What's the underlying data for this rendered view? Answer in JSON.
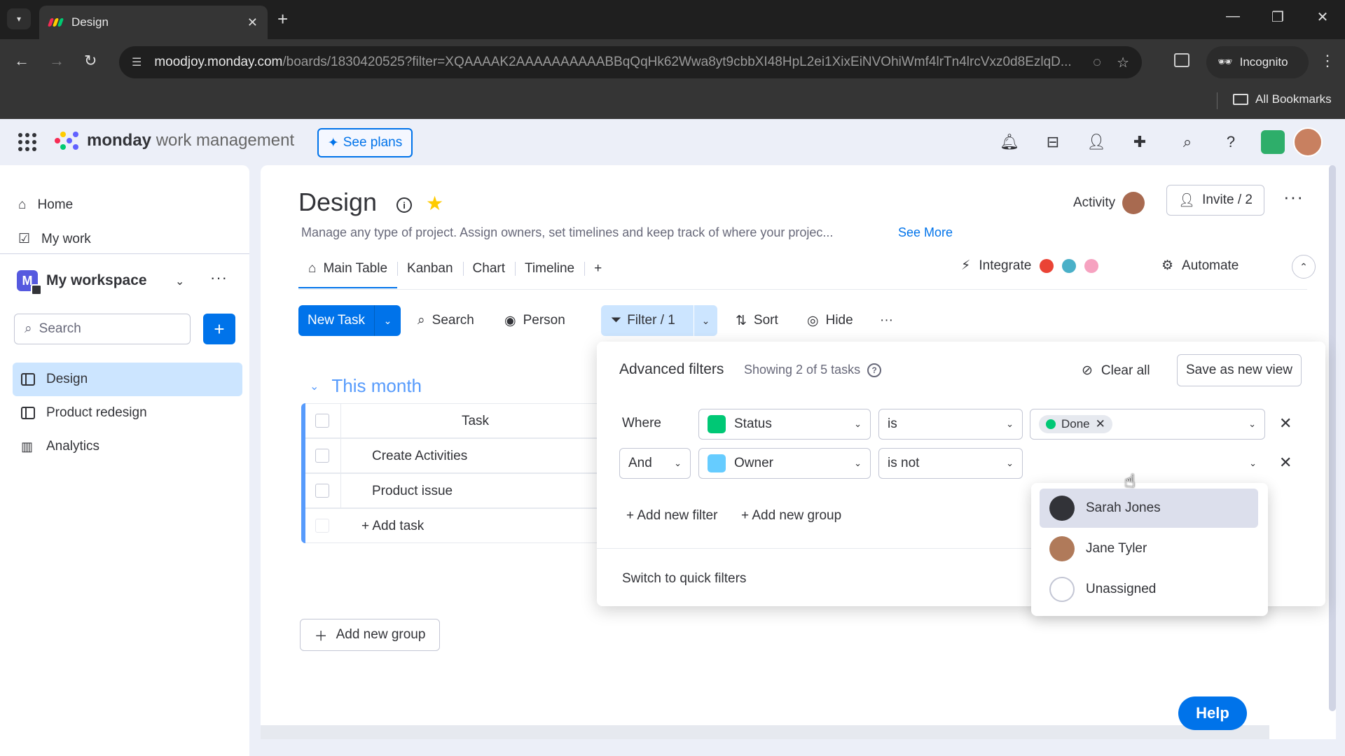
{
  "browser": {
    "tab_title": "Design",
    "url_host": "moodjoy.monday.com",
    "url_path": "/boards/1830420525?filter=XQAAAAK2AAAAAAAAAABBqQqHk62Wwa8yt9cbbXI48HpL2ei1XixEiNVOhiWmf4lrTn4lrcVxz0d8EzlqD...",
    "incognito_label": "Incognito",
    "bookmarks_label": "All Bookmarks"
  },
  "topbar": {
    "brand_bold": "monday",
    "brand_rest": "work management",
    "see_plans": "See plans"
  },
  "sidebar": {
    "nav": [
      {
        "label": "Home"
      },
      {
        "label": "My work"
      }
    ],
    "workspace": {
      "initial": "M",
      "name": "My workspace"
    },
    "search_placeholder": "Search",
    "add_label": "+",
    "boards": [
      {
        "label": "Design",
        "active": true
      },
      {
        "label": "Product redesign"
      },
      {
        "label": "Analytics"
      }
    ]
  },
  "board": {
    "title": "Design",
    "description": "Manage any type of project. Assign owners, set timelines and keep track of where your projec...",
    "see_more": "See More",
    "activity_label": "Activity",
    "invite_label": "Invite / 2",
    "views": [
      {
        "label": "Main Table",
        "active": true
      },
      {
        "label": "Kanban"
      },
      {
        "label": "Chart"
      },
      {
        "label": "Timeline"
      },
      {
        "label": "+"
      }
    ],
    "integrate_label": "Integrate",
    "automate_label": "Automate",
    "toolbar": {
      "new_task": "New Task",
      "search": "Search",
      "person": "Person",
      "filter": "Filter / 1",
      "sort": "Sort",
      "hide": "Hide",
      "more": "···"
    },
    "group": {
      "name": "This month",
      "column_header": "Task",
      "rows": [
        "Create Activities",
        "Product issue"
      ],
      "add_task": "+ Add task"
    },
    "add_group": "Add new group",
    "help": "Help"
  },
  "filters": {
    "title": "Advanced filters",
    "subtitle": "Showing 2 of 5 tasks",
    "clear_all": "Clear all",
    "save_view": "Save as new view",
    "rows": [
      {
        "conj": "Where",
        "column": "Status",
        "operator": "is",
        "value": "Done"
      },
      {
        "conj": "And",
        "column": "Owner",
        "operator": "is not",
        "value": ""
      }
    ],
    "add_filter": "+ Add new filter",
    "add_group": "+ Add new group",
    "quick_filters": "Switch to quick filters",
    "owner_options": [
      {
        "label": "Sarah Jones",
        "highlighted": true
      },
      {
        "label": "Jane Tyler"
      },
      {
        "label": "Unassigned"
      }
    ]
  },
  "colors": {
    "primary": "#0073ea",
    "group_blue": "#579bfc",
    "status_done": "#00c875",
    "selected_bg": "#cce5ff",
    "star": "#ffcb00"
  }
}
